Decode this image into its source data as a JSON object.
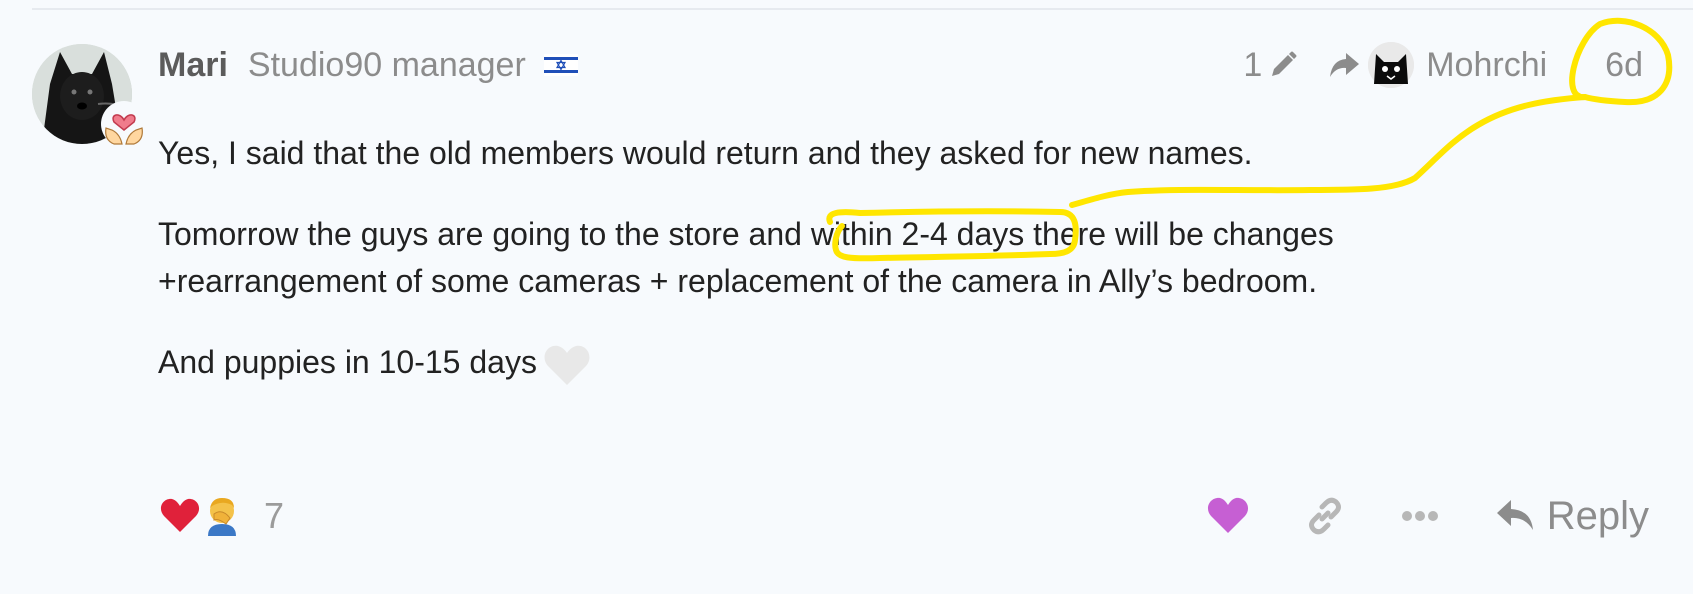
{
  "post": {
    "author": {
      "username": "Mari",
      "title": "Studio90 manager",
      "flag_icon": "israel-flag-icon"
    },
    "meta": {
      "edit_count": "1",
      "reply_to_username": "Mohrchi",
      "date": "6d"
    },
    "body": {
      "paragraph_1": "Yes, I said that the old members would return and they asked for new names.",
      "paragraph_2_before": "Tomorrow the guys are going to the store and ",
      "paragraph_2_highlight": "within 2-4 days",
      "paragraph_2_after": " there will be changes +rearrangement of some cameras + replacement of the camera in Ally’s bedroom.",
      "paragraph_3": "And puppies in 10-15 days"
    },
    "reactions": {
      "icons": [
        "heart-icon",
        "facepalm-emoji"
      ],
      "count": "7"
    },
    "actions": {
      "reply_label": "Reply",
      "icons": [
        "like-heart-icon",
        "link-icon",
        "more-icon",
        "reply-arrow-icon"
      ]
    }
  },
  "colors": {
    "background": "#f7fafd",
    "annotation": "#ffe600",
    "like_active": "#c65fd3",
    "reaction_heart": "#e0213a"
  }
}
